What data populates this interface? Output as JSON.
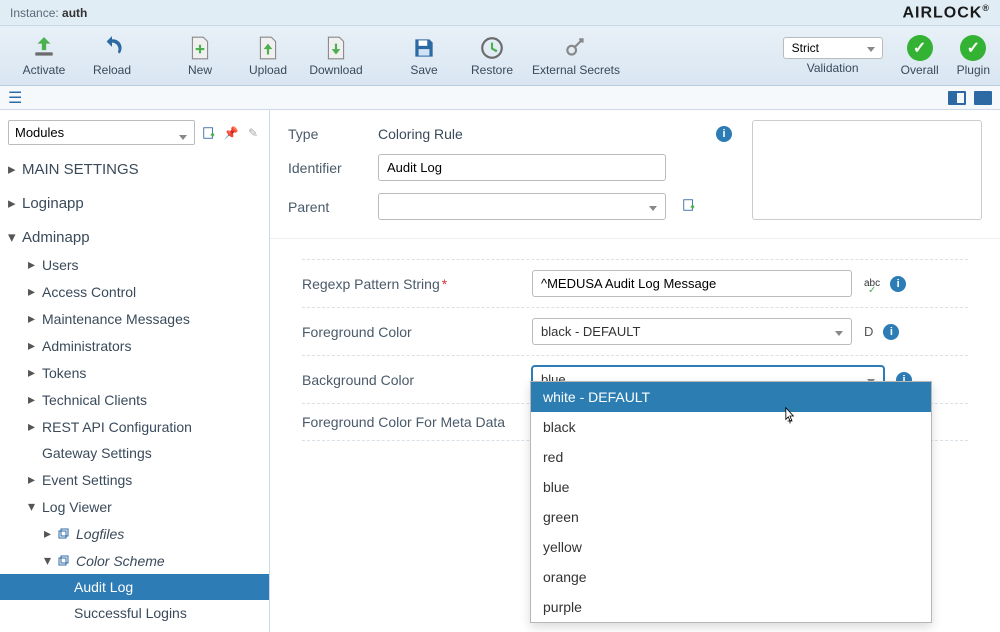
{
  "instance": {
    "label": "Instance:",
    "name": "auth"
  },
  "logo": "AIRLOCK",
  "toolbar": {
    "activate": "Activate",
    "reload": "Reload",
    "new": "New",
    "upload": "Upload",
    "download": "Download",
    "save": "Save",
    "restore": "Restore",
    "external_secrets": "External Secrets",
    "validation_label": "Validation",
    "validation_value": "Strict",
    "overall": "Overall",
    "plugin": "Plugin"
  },
  "sidebar": {
    "dropdown": "Modules",
    "items": [
      {
        "label": "MAIN SETTINGS",
        "level": 0,
        "expanded": false
      },
      {
        "label": "Loginapp",
        "level": 0,
        "expanded": false
      },
      {
        "label": "Adminapp",
        "level": 0,
        "expanded": true
      },
      {
        "label": "Users",
        "level": 1,
        "expanded": false
      },
      {
        "label": "Access Control",
        "level": 1,
        "expanded": false
      },
      {
        "label": "Maintenance Messages",
        "level": 1,
        "expanded": false
      },
      {
        "label": "Administrators",
        "level": 1,
        "expanded": false
      },
      {
        "label": "Tokens",
        "level": 1,
        "expanded": false
      },
      {
        "label": "Technical Clients",
        "level": 1,
        "expanded": false
      },
      {
        "label": "REST API Configuration",
        "level": 1,
        "expanded": false
      },
      {
        "label": "Gateway Settings",
        "level": 1,
        "expanded": null
      },
      {
        "label": "Event Settings",
        "level": 1,
        "expanded": false
      },
      {
        "label": "Log Viewer",
        "level": 1,
        "expanded": true
      },
      {
        "label": "Logfiles",
        "level": 2,
        "expanded": false,
        "icon": true,
        "italic": true
      },
      {
        "label": "Color Scheme",
        "level": 2,
        "expanded": true,
        "icon": true,
        "italic": true
      },
      {
        "label": "Audit Log",
        "level": 3,
        "selected": true
      },
      {
        "label": "Successful Logins",
        "level": 3
      }
    ]
  },
  "header": {
    "type_label": "Type",
    "type_value": "Coloring Rule",
    "identifier_label": "Identifier",
    "identifier_value": "Audit Log",
    "parent_label": "Parent",
    "parent_value": ""
  },
  "form": {
    "regexp_label": "Regexp Pattern String",
    "regexp_value": "^MEDUSA Audit Log Message",
    "fg_label": "Foreground Color",
    "fg_value": "black - DEFAULT",
    "fg_trailing": "D",
    "bg_label": "Background Color",
    "bg_value": "blue",
    "meta_label": "Foreground Color For Meta Data"
  },
  "dropdown_options": [
    "white - DEFAULT",
    "black",
    "red",
    "blue",
    "green",
    "yellow",
    "orange",
    "purple"
  ]
}
